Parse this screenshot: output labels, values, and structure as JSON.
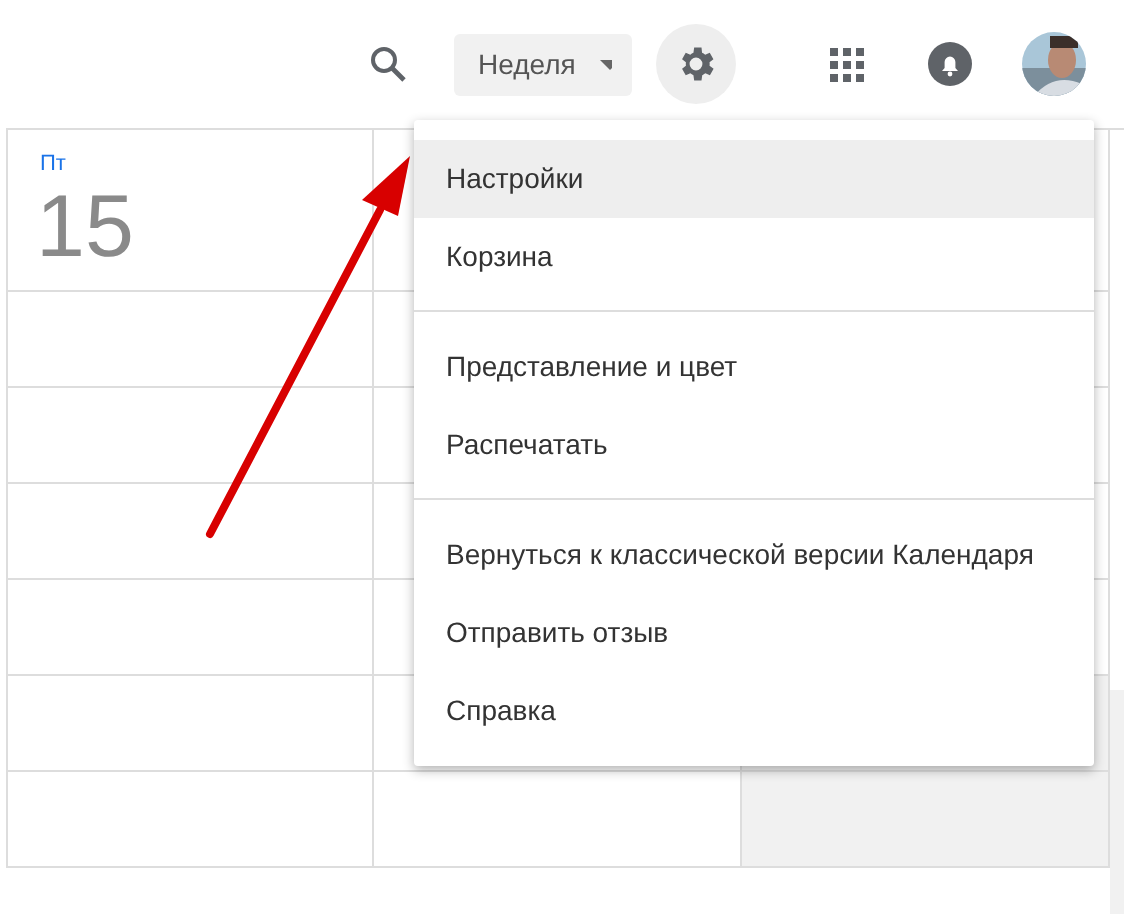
{
  "header": {
    "view_selector": {
      "label": "Неделя"
    }
  },
  "day": {
    "weekday": "Пт",
    "date": "15"
  },
  "settings_menu": {
    "sections": [
      {
        "items": [
          {
            "label": "Настройки",
            "selected": true
          },
          {
            "label": "Корзина",
            "selected": false
          }
        ]
      },
      {
        "items": [
          {
            "label": "Представление и цвет",
            "selected": false
          },
          {
            "label": "Распечатать",
            "selected": false
          }
        ]
      },
      {
        "items": [
          {
            "label": "Вернуться к классической версии Календаря",
            "selected": false
          },
          {
            "label": "Отправить отзыв",
            "selected": false
          },
          {
            "label": "Справка",
            "selected": false
          }
        ]
      }
    ]
  }
}
